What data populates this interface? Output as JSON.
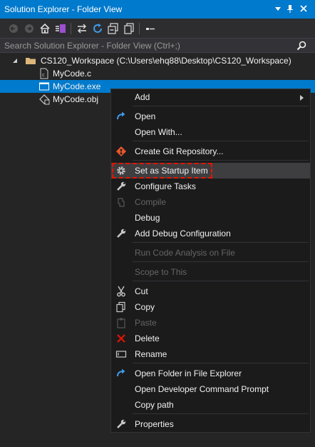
{
  "window": {
    "title": "Solution Explorer - Folder View",
    "colors": {
      "accent": "#007acc",
      "background": "#252526",
      "menu_background": "#1b1b1c",
      "highlight_box": "#e51400"
    }
  },
  "title_controls": [
    "dropdown-icon",
    "pin-icon",
    "close-icon"
  ],
  "toolbar": {
    "icons": [
      "back-icon",
      "forward-icon",
      "home-icon",
      "switch-views-icon",
      "sync-icon",
      "refresh-icon",
      "collapse-all-icon",
      "show-all-files-icon",
      "properties-icon"
    ]
  },
  "search": {
    "placeholder": "Search Solution Explorer - Folder View (Ctrl+;)",
    "value": ""
  },
  "tree": {
    "root": {
      "label": "CS120_Workspace (C:\\Users\\ehq88\\Desktop\\CS120_Workspace)",
      "expanded": true
    },
    "items": [
      {
        "label": "MyCode.c",
        "icon": "c-file-icon",
        "selected": false
      },
      {
        "label": "MyCode.exe",
        "icon": "exe-file-icon",
        "selected": true
      },
      {
        "label": "MyCode.obj",
        "icon": "obj-file-icon",
        "selected": false
      }
    ]
  },
  "context_menu": {
    "items": [
      {
        "label": "Add",
        "icon": "",
        "submenu": true,
        "enabled": true
      },
      {
        "label": "Open",
        "icon": "open-arrow-icon",
        "enabled": true
      },
      {
        "label": "Open With...",
        "icon": "",
        "enabled": true
      },
      {
        "label": "Create Git Repository...",
        "icon": "git-icon",
        "enabled": true
      },
      {
        "label": "Set as Startup Item",
        "icon": "gear-icon",
        "enabled": true,
        "highlighted": true
      },
      {
        "label": "Configure Tasks",
        "icon": "wrench-icon",
        "enabled": true
      },
      {
        "label": "Compile",
        "icon": "compile-icon",
        "enabled": false
      },
      {
        "label": "Debug",
        "icon": "",
        "enabled": true
      },
      {
        "label": "Add Debug Configuration",
        "icon": "wrench-icon",
        "enabled": true
      },
      {
        "label": "Run Code Analysis on File",
        "icon": "",
        "enabled": false
      },
      {
        "label": "Scope to This",
        "icon": "",
        "enabled": false
      },
      {
        "label": "Cut",
        "icon": "scissors-icon",
        "enabled": true
      },
      {
        "label": "Copy",
        "icon": "copy-icon",
        "enabled": true
      },
      {
        "label": "Paste",
        "icon": "paste-icon",
        "enabled": false
      },
      {
        "label": "Delete",
        "icon": "delete-x-icon",
        "enabled": true
      },
      {
        "label": "Rename",
        "icon": "rename-icon",
        "enabled": true
      },
      {
        "label": "Open Folder in File Explorer",
        "icon": "open-arrow-icon",
        "enabled": true
      },
      {
        "label": "Open Developer Command Prompt",
        "icon": "",
        "enabled": true
      },
      {
        "label": "Copy path",
        "icon": "",
        "enabled": true
      },
      {
        "label": "Properties",
        "icon": "wrench-icon",
        "enabled": true
      }
    ]
  }
}
